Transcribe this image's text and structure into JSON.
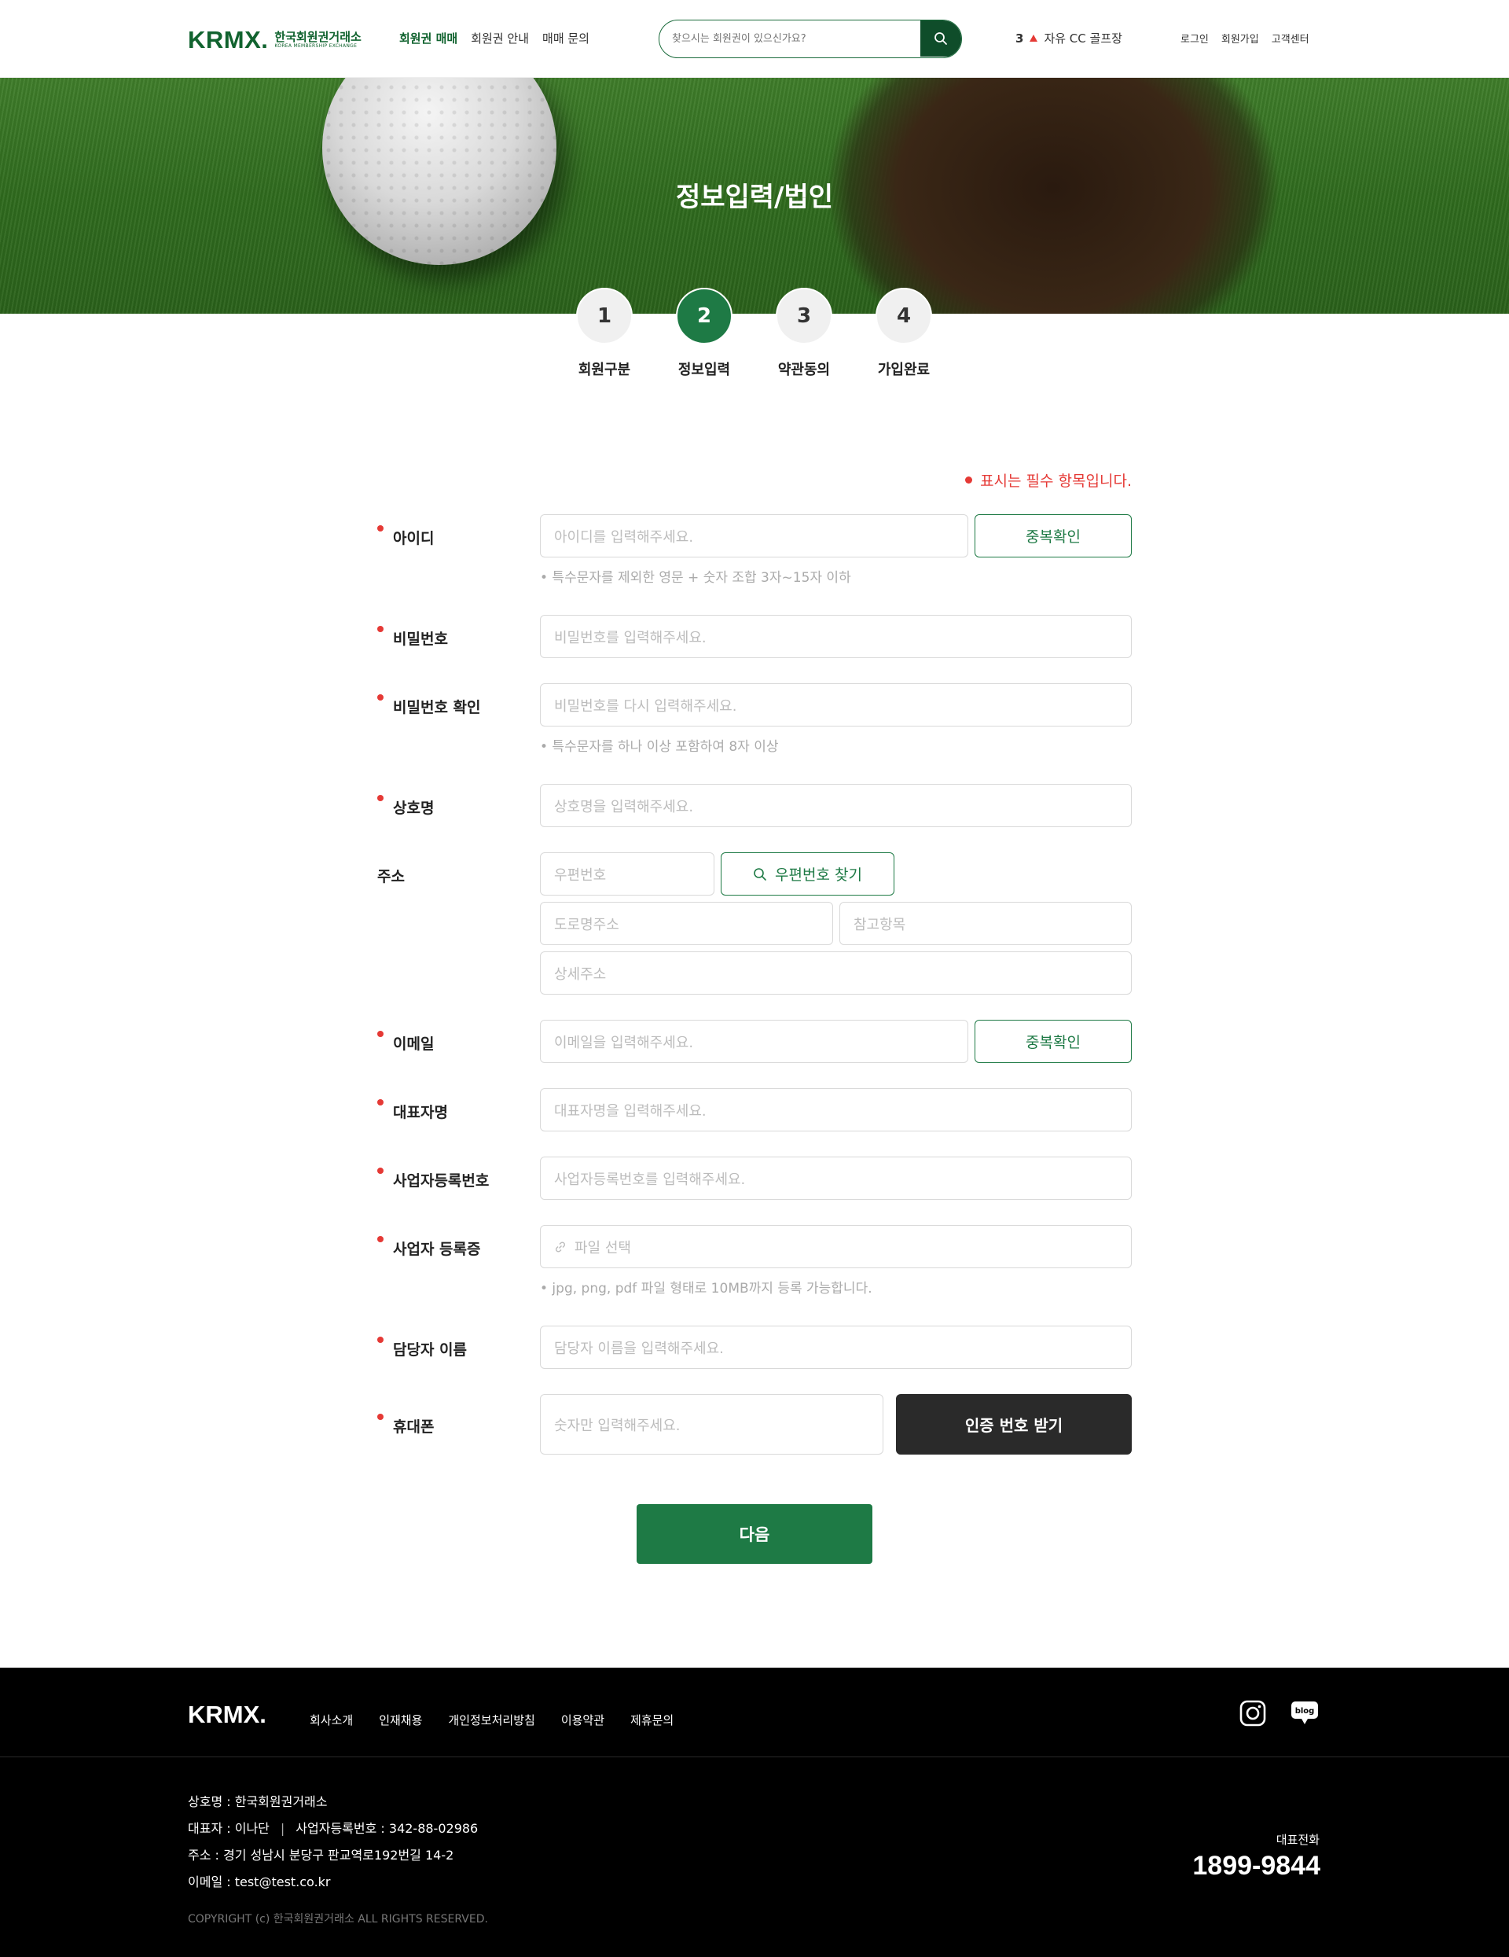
{
  "header": {
    "logo_mark": "KRMX.",
    "logo_kr": "한국회원권거래소",
    "logo_en": "KOREA MEMBERSHIP EXCHANGE",
    "nav": [
      "회원권 매매",
      "회원권 안내",
      "매매 문의"
    ],
    "search_placeholder": "찾으시는 회원권이 있으신가요?",
    "rank_number": "3",
    "rank_item": "자유 CC 골프장",
    "util": [
      "로그인",
      "회원가입",
      "고객센터"
    ]
  },
  "hero": {
    "title": "정보입력/법인"
  },
  "steps": [
    {
      "num": "1",
      "label": "회원구분"
    },
    {
      "num": "2",
      "label": "정보입력"
    },
    {
      "num": "3",
      "label": "약관동의"
    },
    {
      "num": "4",
      "label": "가입완료"
    }
  ],
  "active_step": 2,
  "form": {
    "required_note": "표시는 필수 항목입니다.",
    "id": {
      "label": "아이디",
      "placeholder": "아이디를 입력해주세요.",
      "button": "중복확인",
      "hint": "• 특수문자를 제외한 영문 + 숫자 조합 3자~15자 이하"
    },
    "password": {
      "label": "비밀번호",
      "placeholder": "비밀번호를 입력해주세요."
    },
    "password_confirm": {
      "label": "비밀번호 확인",
      "placeholder": "비밀번호를 다시 입력해주세요.",
      "hint": "• 특수문자를 하나 이상 포함하여 8자 이상"
    },
    "company": {
      "label": "상호명",
      "placeholder": "상호명을 입력해주세요."
    },
    "address": {
      "label": "주소",
      "zip_placeholder": "우편번호",
      "zip_button": "우편번호 찾기",
      "road_placeholder": "도로명주소",
      "ref_placeholder": "참고항목",
      "detail_placeholder": "상세주소"
    },
    "email": {
      "label": "이메일",
      "placeholder": "이메일을 입력해주세요.",
      "button": "중복확인"
    },
    "ceo": {
      "label": "대표자명",
      "placeholder": "대표자명을 입력해주세요."
    },
    "biz_no": {
      "label": "사업자등록번호",
      "placeholder": "사업자등록번호를 입력해주세요."
    },
    "biz_cert": {
      "label": "사업자 등록증",
      "placeholder": "파일 선택",
      "hint": "• jpg, png, pdf 파일 형태로 10MB까지 등록 가능합니다."
    },
    "manager": {
      "label": "담당자 이름",
      "placeholder": "담당자 이름을 입력해주세요."
    },
    "phone": {
      "label": "휴대폰",
      "placeholder": "숫자만 입력해주세요.",
      "button": "인증 번호 받기"
    },
    "next_button": "다음"
  },
  "footer": {
    "logo": "KRMX.",
    "nav": [
      "회사소개",
      "인재채용",
      "개인정보처리방침",
      "이용약관",
      "제휴문의"
    ],
    "company_line": "상호명 : 한국회원권거래소",
    "ceo_line": "대표자 : 이나단",
    "biz_line": "사업자등록번호 : 342-88-02986",
    "address_line": "주소 : 경기 성남시 분당구 판교역로192번길 14-2",
    "email_line": "이메일 : test@test.co.kr",
    "copyright": "COPYRIGHT (c) 한국회원권거래소 ALL RIGHTS RESERVED.",
    "tel_label": "대표전화",
    "tel": "1899-9844",
    "blog_badge": "blog"
  },
  "colors": {
    "brand": "#1e7a45",
    "brand_dark": "#0f4d2a",
    "required": "#e53935"
  }
}
